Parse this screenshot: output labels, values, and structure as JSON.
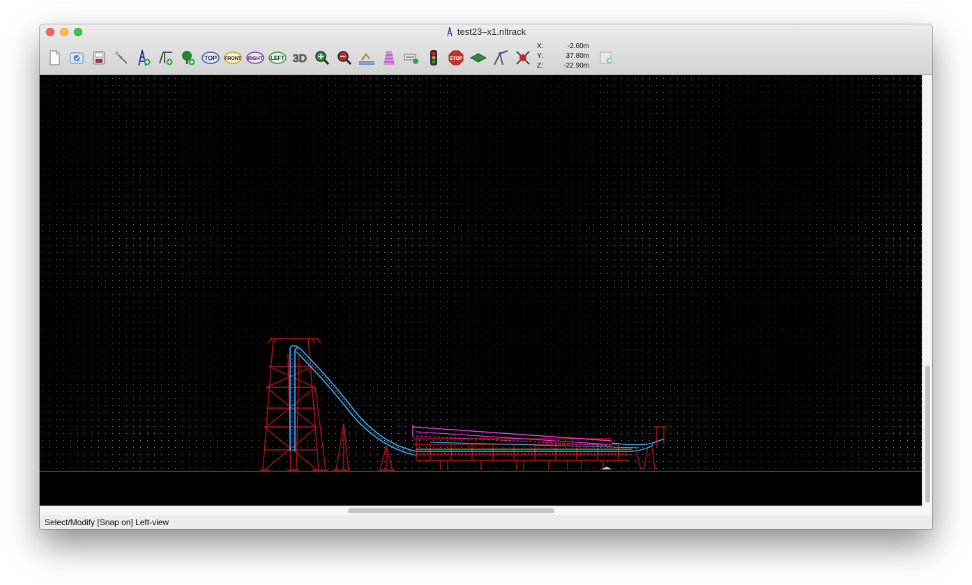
{
  "window": {
    "title": "test23–x1.nltrack"
  },
  "toolbar": {
    "buttons": [
      {
        "name": "new-document-icon"
      },
      {
        "name": "open-file-icon"
      },
      {
        "name": "save-file-icon"
      },
      {
        "name": "select-modify-icon"
      },
      {
        "name": "add-support-icon"
      },
      {
        "name": "add-track-icon"
      },
      {
        "name": "add-tree-icon"
      },
      {
        "name": "view-top-icon",
        "label": "TOP",
        "color": "#2b56c7"
      },
      {
        "name": "view-front-icon",
        "label": "FRONT",
        "color": "#c8a01a"
      },
      {
        "name": "view-right-icon",
        "label": "RIGHT",
        "color": "#8a2fb0"
      },
      {
        "name": "view-left-icon",
        "label": "LEFT",
        "color": "#2e9a3a"
      },
      {
        "name": "view-3d-icon",
        "label": "3D"
      },
      {
        "name": "zoom-in-icon"
      },
      {
        "name": "zoom-out-icon"
      },
      {
        "name": "station-icon"
      },
      {
        "name": "lift-hill-icon"
      },
      {
        "name": "brake-icon"
      },
      {
        "name": "signal-icon"
      },
      {
        "name": "stop-icon",
        "label": "STOP"
      },
      {
        "name": "terrain-icon"
      },
      {
        "name": "crane-icon"
      },
      {
        "name": "test-run-icon"
      },
      {
        "name": "export-icon"
      }
    ]
  },
  "coords": {
    "x": {
      "label": "X:",
      "value": "-2.60m"
    },
    "y": {
      "label": "Y:",
      "value": "37.80m"
    },
    "z": {
      "label": "Z:",
      "value": "-22.90m"
    }
  },
  "status": {
    "text": "Select/Modify [Snap on] Left-view"
  },
  "colors": {
    "background": "#000000",
    "grid_dots": "#8a8a8a",
    "ground_line": "#22c322",
    "support": "#b3121a",
    "track_rail": "#3fb7ff",
    "track_highlight": "#e040e0",
    "track_yellow": "#e0d030"
  }
}
